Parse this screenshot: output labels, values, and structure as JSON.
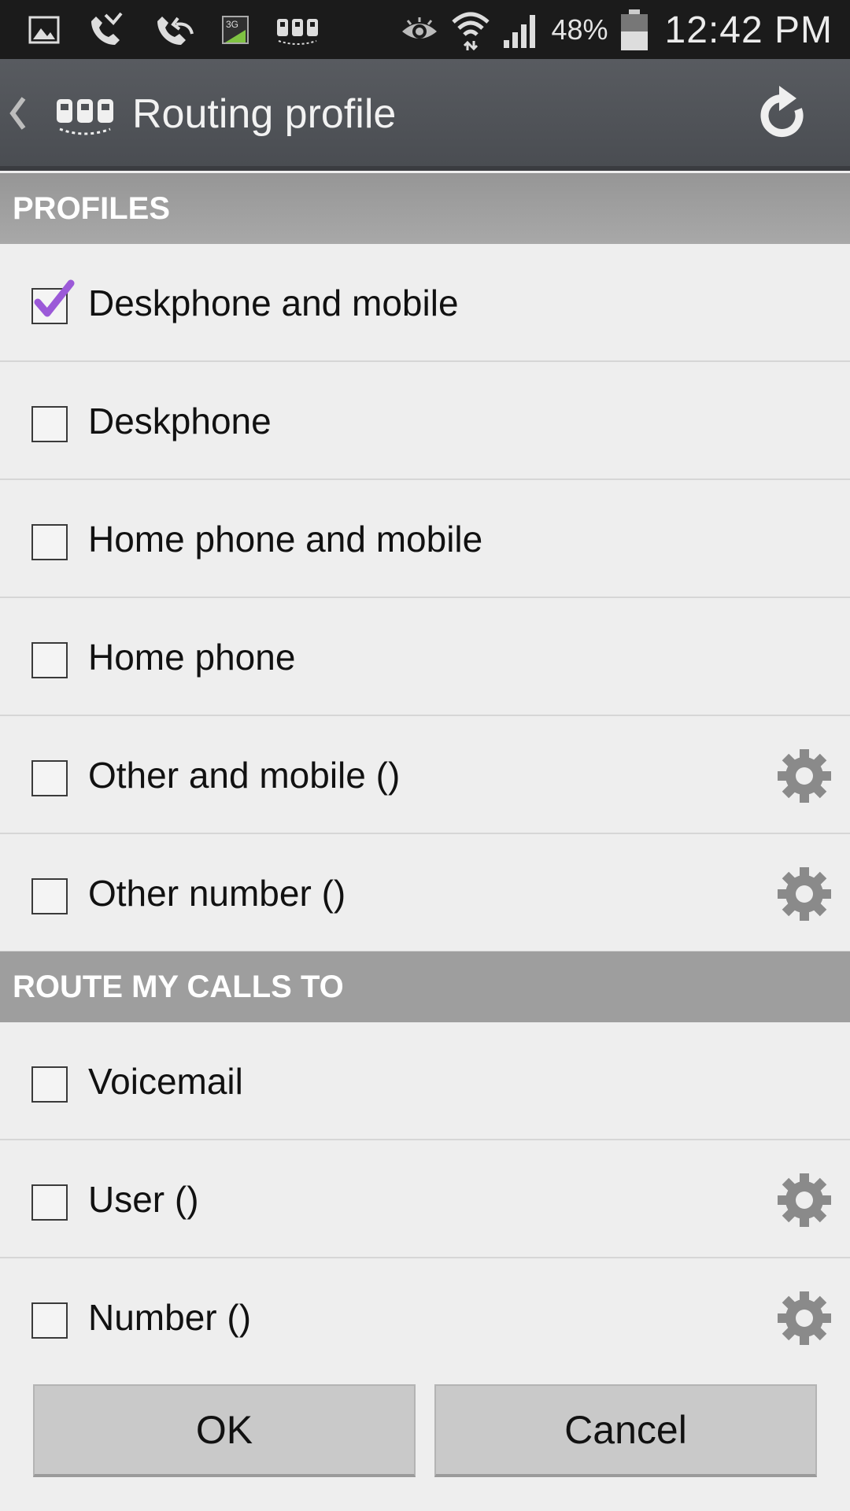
{
  "status_bar": {
    "icons_left": [
      "gallery-icon",
      "missed-call-icon",
      "call-forward-icon",
      "3g-icon",
      "app-logo-icon"
    ],
    "icons_right": [
      "eye-icon",
      "wifi-icon",
      "signal-icon",
      "battery-icon"
    ],
    "battery": "48%",
    "time": "12:42 PM"
  },
  "action_bar": {
    "title": "Routing profile",
    "back_icon": "chevron-left-icon",
    "logo_icon": "app-logo-icon",
    "refresh_icon": "refresh-icon"
  },
  "sections": {
    "profiles": "PROFILES",
    "route": "ROUTE MY CALLS TO"
  },
  "profiles": [
    {
      "label": "Deskphone and mobile",
      "checked": true,
      "gear": false
    },
    {
      "label": "Deskphone",
      "checked": false,
      "gear": false
    },
    {
      "label": "Home phone and mobile",
      "checked": false,
      "gear": false
    },
    {
      "label": "Home phone",
      "checked": false,
      "gear": false
    },
    {
      "label": "Other and mobile ()",
      "checked": false,
      "gear": true
    },
    {
      "label": "Other number ()",
      "checked": false,
      "gear": true
    }
  ],
  "route": [
    {
      "label": "Voicemail",
      "checked": false,
      "gear": false
    },
    {
      "label": "User ()",
      "checked": false,
      "gear": true
    },
    {
      "label": "Number ()",
      "checked": false,
      "gear": true
    }
  ],
  "buttons": {
    "ok": "OK",
    "cancel": "Cancel"
  },
  "colors": {
    "accent_check": "#9b59d8",
    "header_bg": "#a3a3a3",
    "actionbar_bg": "#4f5257"
  }
}
